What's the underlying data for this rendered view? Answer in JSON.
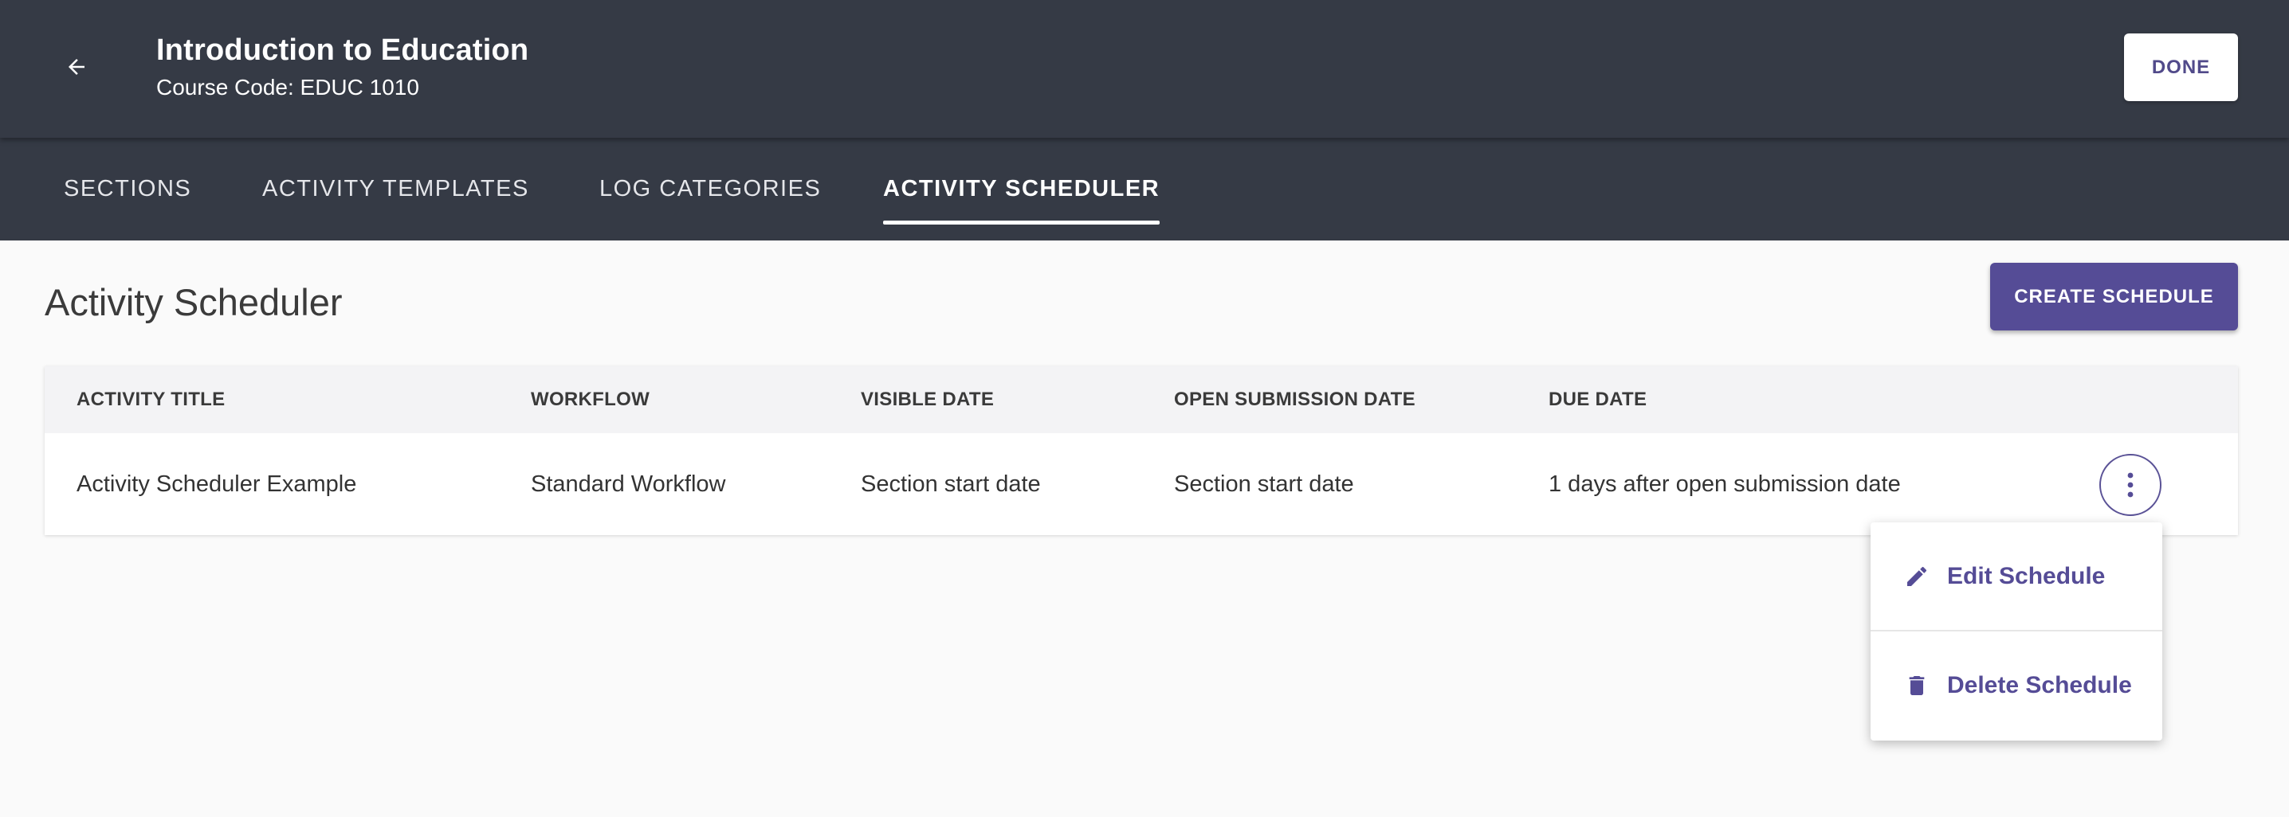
{
  "header": {
    "course_title": "Introduction to Education",
    "course_code": "Course Code: EDUC 1010",
    "done_label": "DONE"
  },
  "tabs": [
    {
      "label": "SECTIONS",
      "active": false
    },
    {
      "label": "ACTIVITY TEMPLATES",
      "active": false
    },
    {
      "label": "LOG CATEGORIES",
      "active": false
    },
    {
      "label": "ACTIVITY SCHEDULER",
      "active": true
    }
  ],
  "page": {
    "title": "Activity Scheduler",
    "create_label": "CREATE SCHEDULE"
  },
  "table": {
    "columns": [
      "ACTIVITY TITLE",
      "WORKFLOW",
      "VISIBLE DATE",
      "OPEN SUBMISSION DATE",
      "DUE DATE"
    ],
    "rows": [
      [
        "Activity Scheduler Example",
        "Standard Workflow",
        "Section start date",
        "Section start date",
        "1 days after open submission date"
      ]
    ]
  },
  "menu": {
    "items": [
      {
        "label": "Edit Schedule",
        "icon": "pencil-icon"
      },
      {
        "label": "Delete Schedule",
        "icon": "trash-icon"
      }
    ]
  },
  "colors": {
    "header_bg": "#353a45",
    "accent": "#554c96",
    "page_bg": "#fafafa"
  }
}
